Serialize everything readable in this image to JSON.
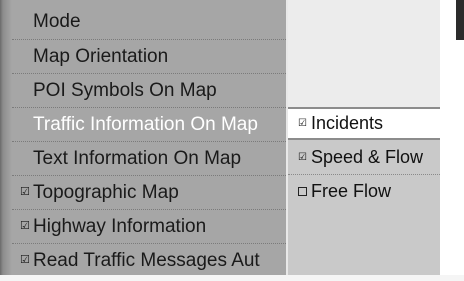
{
  "main_menu": {
    "items": [
      {
        "label": "Mode",
        "check": ""
      },
      {
        "label": "Map Orientation",
        "check": ""
      },
      {
        "label": "POI Symbols On Map",
        "check": ""
      },
      {
        "label": "Traffic Information On Map",
        "check": ""
      },
      {
        "label": "Text Information On Map",
        "check": ""
      },
      {
        "label": "Topographic Map",
        "check": "☑"
      },
      {
        "label": "Highway Information",
        "check": "☑"
      },
      {
        "label": "Read Traffic Messages Aut",
        "check": "☑"
      }
    ],
    "selected_index": 3
  },
  "sub_menu": {
    "items": [
      {
        "label": "Incidents",
        "check": "☑"
      },
      {
        "label": "Speed & Flow",
        "check": "☑"
      },
      {
        "label": "Free Flow",
        "check": ""
      }
    ],
    "highlighted_index": 0
  },
  "colors": {
    "main_bg": "#a6a6a6",
    "sub_bg": "#c9c9c9",
    "selected_text": "#ffffff",
    "normal_text": "#1a1a1a"
  }
}
